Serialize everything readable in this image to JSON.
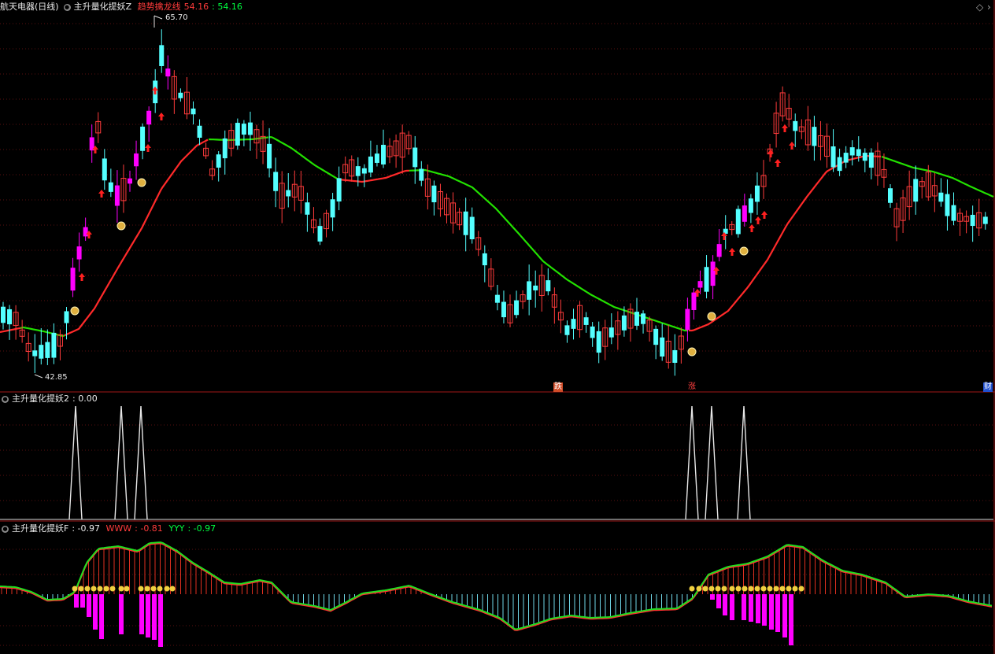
{
  "main": {
    "stock": "航天电器(日线)",
    "indicator": "主升量化提妖Z",
    "trend_label": "趋势擒龙线",
    "trend_value": "54.16",
    "trend_value2": ": 54.16",
    "high_label": "65.70",
    "low_label": "42.85",
    "tags": [
      "跌",
      "涨",
      "财"
    ],
    "colors": {
      "up": "#ff3b3b",
      "down": "#54ffff",
      "signal": "#ff00ff",
      "trend_up": "#ff2a2a",
      "trend_down": "#22e000"
    }
  },
  "sub1": {
    "title": "主升量化提妖2",
    "value": ": 0.00"
  },
  "sub2": {
    "title": "主升量化提妖F",
    "value": ": -0.97",
    "label_w": "WWW",
    "value_w": ": -0.81",
    "label_y": "YYY",
    "value_y": ": -0.97"
  },
  "controls": [
    "◇",
    "›"
  ]
}
